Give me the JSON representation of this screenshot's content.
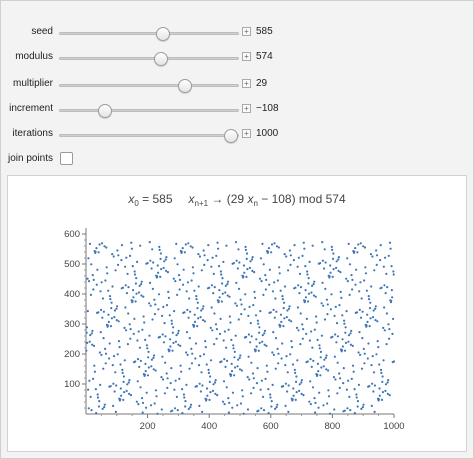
{
  "controls": {
    "sliders": [
      {
        "id": "seed",
        "label": "seed",
        "value": "585",
        "fraction": 0.58
      },
      {
        "id": "modulus",
        "label": "modulus",
        "value": "574",
        "fraction": 0.57
      },
      {
        "id": "multiplier",
        "label": "multiplier",
        "value": "29",
        "fraction": 0.7
      },
      {
        "id": "increment",
        "label": "increment",
        "value": "−108",
        "fraction": 0.25
      },
      {
        "id": "iterations",
        "label": "iterations",
        "value": "1000",
        "fraction": 0.96
      }
    ],
    "join_points": {
      "label": "join points",
      "checked": false
    },
    "plus_symbol": "+"
  },
  "plot": {
    "title": {
      "x0_var": "x",
      "x0_sub": "0",
      "x0_eq": " = 585",
      "xn1_var": "x",
      "xn1_sub": "n+1",
      "arrow_part": " → (29 ",
      "xn_var": "x",
      "xn_sub": "n",
      "tail": " − 108) mod 574"
    },
    "point_color": "#3f74b5"
  },
  "chart_data": {
    "type": "scatter",
    "title": "x0 = 585    xn+1 → (29 xn − 108) mod 574",
    "xlim": [
      0,
      1000
    ],
    "ylim": [
      0,
      620
    ],
    "x_ticks": [
      200,
      400,
      600,
      800,
      1000
    ],
    "y_ticks": [
      100,
      200,
      300,
      400,
      500,
      600
    ],
    "x_tick_labels": [
      "200",
      "400",
      "600",
      "800",
      "1000"
    ],
    "y_tick_labels": [
      "100",
      "200",
      "300",
      "400",
      "500",
      "600"
    ],
    "generator": {
      "seed": 585,
      "modulus": 574,
      "multiplier": 29,
      "increment": -108,
      "iterations": 1000
    },
    "grid": false,
    "xlabel": "",
    "ylabel": ""
  }
}
